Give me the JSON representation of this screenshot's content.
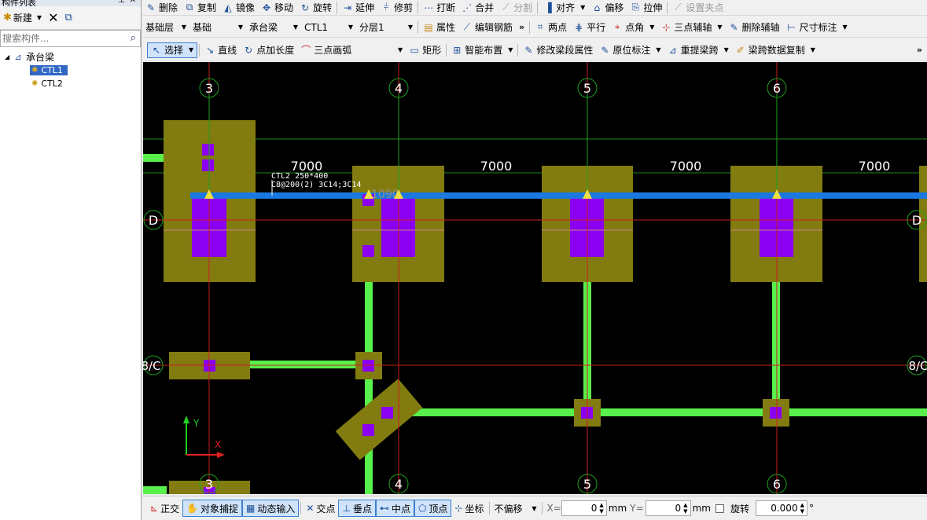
{
  "left_panel": {
    "title": "构件列表",
    "toolbar": {
      "new_label": "新建"
    },
    "search_placeholder": "搜索构件...",
    "tree": {
      "root_label": "承台梁",
      "children": [
        "CTL1",
        "CTL2"
      ]
    }
  },
  "toolbar1": {
    "delete": "删除",
    "copy": "复制",
    "mirror": "镜像",
    "move": "移动",
    "rotate": "旋转",
    "extend": "延伸",
    "trim": "修剪",
    "break": "打断",
    "merge": "合并",
    "split": "分割",
    "align": "对齐",
    "offset": "偏移",
    "stretch": "拉伸",
    "set_grip": "设置夹点"
  },
  "toolbar2": {
    "floor": "基础层",
    "category": "基础",
    "type": "承台梁",
    "component": "CTL1",
    "layer": "分层1",
    "properties": "属性",
    "edit_rebar": "编辑钢筋",
    "two_points": "两点",
    "parallel": "平行",
    "point_angle": "点角",
    "three_point_axis": "三点辅轴",
    "delete_axis": "删除辅轴",
    "dimension": "尺寸标注"
  },
  "toolbar3": {
    "select": "选择",
    "line": "直线",
    "point_length": "点加长度",
    "three_point_arc": "三点画弧",
    "rectangle": "矩形",
    "smart_layout": "智能布置",
    "modify_segment": "修改梁段属性",
    "original_label": "原位标注",
    "relift_span": "重提梁跨",
    "span_copy": "梁跨数据复制"
  },
  "canvas": {
    "grid_top": [
      "3",
      "4",
      "5",
      "6"
    ],
    "grid_bottom": [
      "3",
      "4",
      "5",
      "6"
    ],
    "spans": [
      "7000",
      "7000",
      "7000",
      "7000"
    ],
    "row_D": "D",
    "row_8C": "8/C",
    "beam_label_line1": "CTL2 250*400",
    "beam_label_line2": "C8@200(2) 3C14;3C14",
    "dim_1090": "1090",
    "axis_y": "Y",
    "axis_x": "X",
    "colors": {
      "background": "#000000",
      "cap": "#827c10",
      "column": "#8b00f0",
      "beam_green": "#58f04a",
      "beam_blue": "#1a78e0",
      "axis_green": "#1f9a1f",
      "axis_red": "#c81e1e"
    }
  },
  "statusbar": {
    "ortho": "正交",
    "snap": "对象捕捉",
    "dynamic_input": "动态输入",
    "intersection": "交点",
    "perpendicular": "垂点",
    "midpoint": "中点",
    "vertex": "顶点",
    "coordinate": "坐标",
    "offset_mode": "不偏移",
    "x_label": "X=",
    "x_value": "0",
    "y_label": "Y=",
    "y_value": "0",
    "mm": "mm",
    "rotate": "旋转",
    "rotate_value": "0.000",
    "degree": "°"
  }
}
